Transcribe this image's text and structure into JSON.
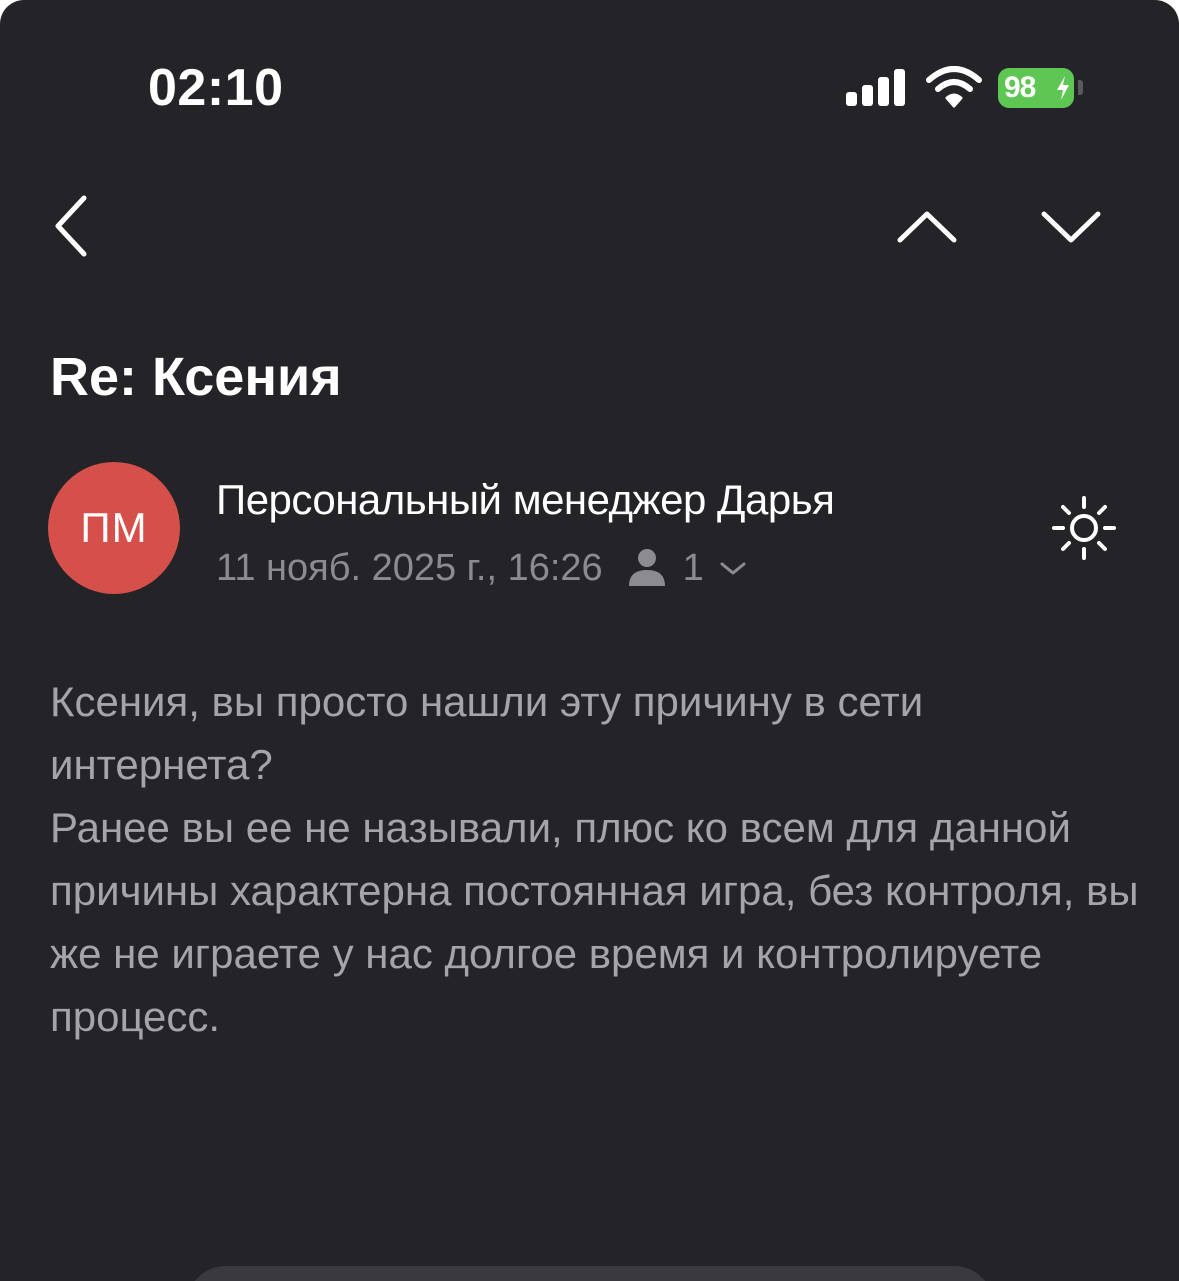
{
  "status_bar": {
    "time": "02:10",
    "battery": "98",
    "icons": [
      "signal-icon",
      "wifi-icon",
      "battery-icon",
      "charging-icon"
    ]
  },
  "nav": {
    "icons": [
      "chevron-left-icon",
      "chevron-up-icon",
      "chevron-down-icon"
    ]
  },
  "email": {
    "subject": "Re: Ксения",
    "avatar_initials": "ПМ",
    "sender": "Персональный менеджер Дарья",
    "date": "11 нояб. 2025 г., 16:26",
    "recipients_count": "1",
    "body": [
      "Ксения, вы просто нашли эту причину в сети интернета?",
      "Ранее вы ее не называли, плюс ко всем для данной причины характерна постоянная игра, без контроля, вы же не играете у нас долгое время и контролируете процесс."
    ]
  },
  "colors": {
    "background": "#242328",
    "avatar": "#d5504a",
    "battery": "#5ec754",
    "body_text": "#a4a4aa",
    "meta_text": "#8b8b91"
  }
}
